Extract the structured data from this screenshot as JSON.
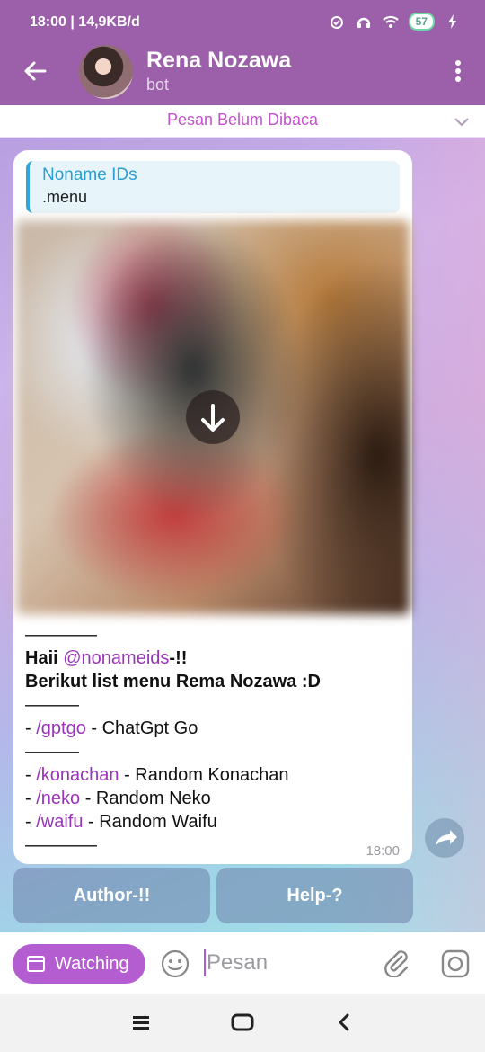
{
  "status_bar": {
    "time_speed": "18:00 | 14,9KB/d",
    "battery": "57"
  },
  "header": {
    "name": "Rena Nozawa",
    "subtitle": "bot"
  },
  "pinned": {
    "label": "Pesan Belum Dibaca"
  },
  "message": {
    "reply": {
      "author": "Noname IDs",
      "text": ".menu"
    },
    "lines": {
      "sep1": "————",
      "greet_pre": "Haii ",
      "greet_mention": "@nonameids",
      "greet_post": "-!!",
      "intro": "Berikut list menu Rema Nozawa :D",
      "sep2": "———",
      "gptgo_dash": "- ",
      "gptgo_cmd": "/gptgo",
      "gptgo_desc": " - ChatGpt Go",
      "sep3": "———",
      "konachan_dash": "- ",
      "konachan_cmd": "/konachan",
      "konachan_desc": " - Random Konachan",
      "neko_dash": "- ",
      "neko_cmd": "/neko",
      "neko_desc": " - Random Neko",
      "waifu_dash": "- ",
      "waifu_cmd": "/waifu",
      "waifu_desc": " - Random Waifu",
      "sep4": "————"
    },
    "time": "18:00"
  },
  "keyboard": {
    "author_label": "Author-!!",
    "help_label": "Help-?"
  },
  "input": {
    "watching_label": "Watching",
    "placeholder": "Pesan"
  },
  "colors": {
    "header": "#9c5fa9",
    "accent": "#b35dd0",
    "link": "#9a35b8",
    "reply_accent": "#2fa7d8"
  }
}
